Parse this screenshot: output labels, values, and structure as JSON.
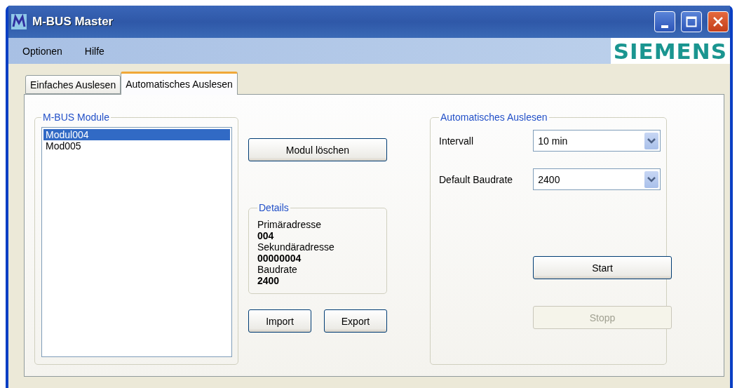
{
  "window": {
    "title": "M-BUS Master"
  },
  "menu": [
    "Optionen",
    "Hilfe"
  ],
  "logo": "SIEMENS",
  "tabs": [
    {
      "label": "Einfaches Auslesen",
      "selected": false
    },
    {
      "label": "Automatisches Auslesen",
      "selected": true
    }
  ],
  "modules": {
    "title": "M-BUS Module",
    "items": [
      {
        "label": "Modul004",
        "selected": true
      },
      {
        "label": "Mod005",
        "selected": false
      }
    ]
  },
  "delete_button": "Modul löschen",
  "details": {
    "title": "Details",
    "fields": [
      {
        "label": "Primäradresse",
        "value": "004"
      },
      {
        "label": "Sekundäradresse",
        "value": "00000004"
      },
      {
        "label": "Baudrate",
        "value": "2400"
      }
    ]
  },
  "import_button": "Import",
  "export_button": "Export",
  "auto": {
    "title": "Automatisches Auslesen",
    "fields": [
      {
        "label": "Intervall",
        "value": "10 min"
      },
      {
        "label": "Default Baudrate",
        "value": "2400"
      }
    ],
    "buttons": [
      {
        "label": "Start",
        "disabled": false
      },
      {
        "label": "Stopp",
        "disabled": true
      }
    ]
  }
}
